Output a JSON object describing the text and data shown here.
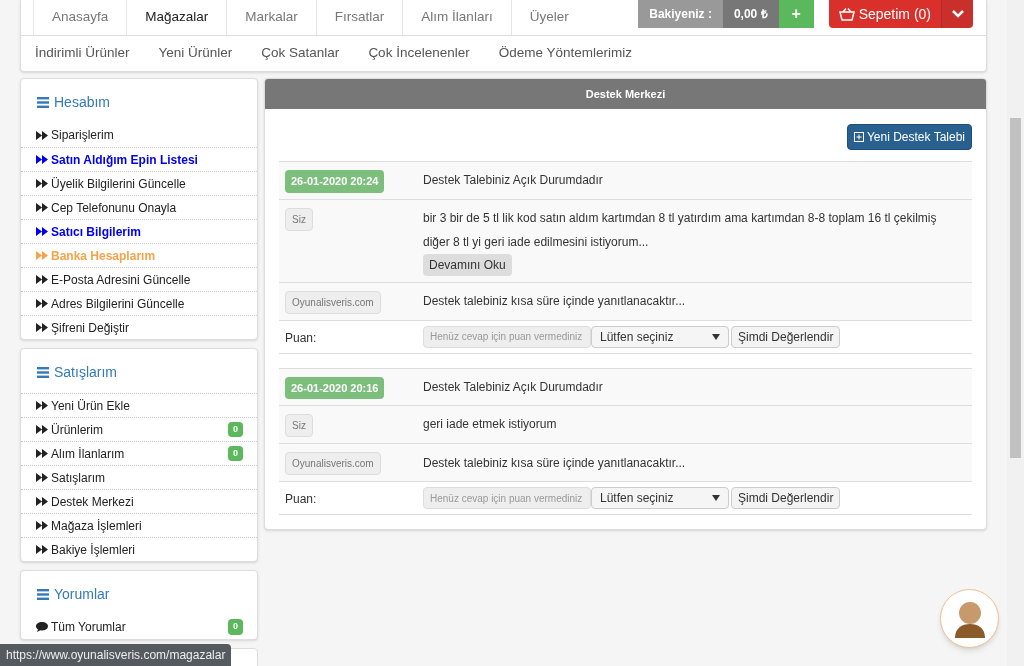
{
  "top_nav": {
    "items": [
      {
        "label": "Anasayfa",
        "selected": false
      },
      {
        "label": "Mağazalar",
        "selected": true
      },
      {
        "label": "Markalar",
        "selected": false
      },
      {
        "label": "Fırsatlar",
        "selected": false
      },
      {
        "label": "Alım İlanları",
        "selected": false
      },
      {
        "label": "Üyeler",
        "selected": false
      }
    ],
    "balance_label": "Bakiyeniz :",
    "balance_value": "0,00 ₺",
    "add_button": "+",
    "cart_button": "Sepetim (0)"
  },
  "sub_nav": [
    "İndirimli Ürünler",
    "Yeni Ürünler",
    "Çok Satanlar",
    "Çok İncelenenler",
    "Ödeme Yöntemlerimiz"
  ],
  "sidebar": [
    {
      "title": "Hesabım",
      "items": [
        {
          "label": "Siparişlerim",
          "kind": "normal"
        },
        {
          "label": "Satın Aldığım Epin Listesi",
          "kind": "featured"
        },
        {
          "label": "Üyelik Bilgilerini Güncelle",
          "kind": "normal"
        },
        {
          "label": "Cep Telefonunu Onayla",
          "kind": "normal"
        },
        {
          "label": "Satıcı Bilgilerim",
          "kind": "featured"
        },
        {
          "label": "Banka Hesaplarım",
          "kind": "warning"
        },
        {
          "label": "E-Posta Adresini Güncelle",
          "kind": "normal"
        },
        {
          "label": "Adres Bilgilerini Güncelle",
          "kind": "normal"
        },
        {
          "label": "Şifreni Değiştir",
          "kind": "normal"
        }
      ]
    },
    {
      "title": "Satışlarım",
      "items": [
        {
          "label": "Yeni Ürün Ekle",
          "kind": "normal"
        },
        {
          "label": "Ürünlerim",
          "kind": "normal",
          "badge": "0"
        },
        {
          "label": "Alım İlanlarım",
          "kind": "normal",
          "badge": "0"
        },
        {
          "label": "Satışlarım",
          "kind": "normal"
        },
        {
          "label": "Destek Merkezi",
          "kind": "normal"
        },
        {
          "label": "Mağaza İşlemleri",
          "kind": "normal"
        },
        {
          "label": "Bakiye İşlemleri",
          "kind": "normal"
        }
      ]
    },
    {
      "title": "Yorumlar",
      "items": [
        {
          "label": "Tüm Yorumlar",
          "kind": "comment",
          "badge": "0"
        }
      ]
    }
  ],
  "panel": {
    "title": "Destek Merkezi",
    "new_button": "Yeni Destek Talebi",
    "tickets": [
      {
        "date": "26-01-2020 20:24",
        "status": "Destek Talebiniz Açık Durumdadır",
        "author": "Siz",
        "message": "bir 3 bir de 5 tl lik kod satın aldım kartımdan 8 tl yatırdım ama kartımdan 8-8 toplam 16 tl çekilmiş diğer 8 tl yi geri iade edilmesini istiyorum...",
        "more_button": "Devamını Oku",
        "reply_author": "Oyunalisveris.com",
        "reply": "Destek talebiniz kısa süre içinde yanıtlanacaktır...",
        "rating_label": "Puan:",
        "rating_placeholder": "Henüz cevap için puan vermediniz",
        "rating_select": "Lütfen seçiniz",
        "rate_button": "Şimdi Değerlendir"
      },
      {
        "date": "26-01-2020 20:16",
        "status": "Destek Talebiniz Açık Durumdadır",
        "author": "Siz",
        "message": "geri iade etmek istiyorum",
        "reply_author": "Oyunalisveris.com",
        "reply": "Destek talebiniz kısa süre içinde yanıtlanacaktır...",
        "rating_label": "Puan:",
        "rating_placeholder": "Henüz cevap için puan vermediniz",
        "rating_select": "Lütfen seçiniz",
        "rate_button": "Şimdi Değerlendir"
      }
    ]
  },
  "status_url": "https://www.oyunalisveris.com/magazalar"
}
